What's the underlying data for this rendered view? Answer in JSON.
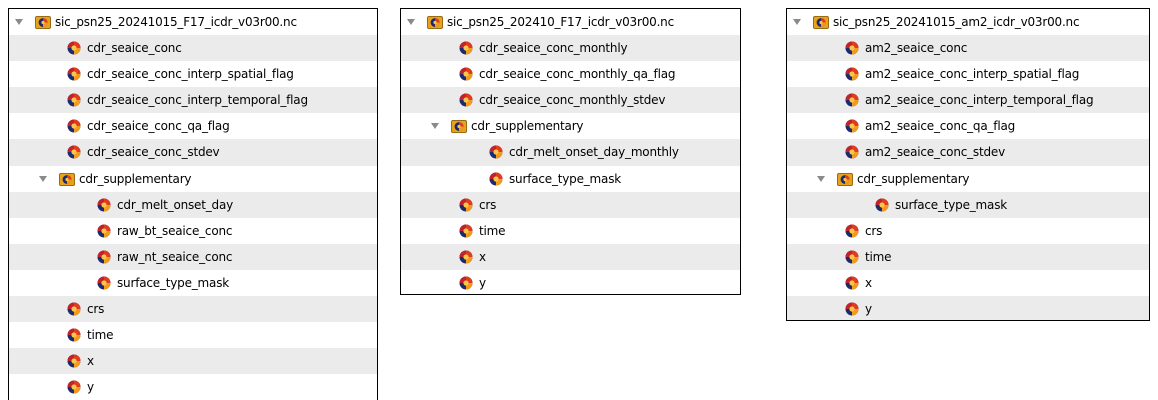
{
  "panels": [
    {
      "id": "a",
      "root": "sic_psn25_20241015_F17_icdr_v03r00.nc",
      "items": [
        {
          "label": "cdr_seaice_conc",
          "level": 1,
          "type": "var"
        },
        {
          "label": "cdr_seaice_conc_interp_spatial_flag",
          "level": 1,
          "type": "var"
        },
        {
          "label": "cdr_seaice_conc_interp_temporal_flag",
          "level": 1,
          "type": "var"
        },
        {
          "label": "cdr_seaice_conc_qa_flag",
          "level": 1,
          "type": "var"
        },
        {
          "label": "cdr_seaice_conc_stdev",
          "level": 1,
          "type": "var"
        },
        {
          "label": "cdr_supplementary",
          "level": 1,
          "type": "group"
        },
        {
          "label": "cdr_melt_onset_day",
          "level": 2,
          "type": "var"
        },
        {
          "label": "raw_bt_seaice_conc",
          "level": 2,
          "type": "var"
        },
        {
          "label": "raw_nt_seaice_conc",
          "level": 2,
          "type": "var"
        },
        {
          "label": "surface_type_mask",
          "level": 2,
          "type": "var"
        },
        {
          "label": "crs",
          "level": 1,
          "type": "var"
        },
        {
          "label": "time",
          "level": 1,
          "type": "var"
        },
        {
          "label": "x",
          "level": 1,
          "type": "var"
        },
        {
          "label": "y",
          "level": 1,
          "type": "var"
        }
      ]
    },
    {
      "id": "b",
      "root": "sic_psn25_202410_F17_icdr_v03r00.nc",
      "items": [
        {
          "label": "cdr_seaice_conc_monthly",
          "level": 1,
          "type": "var"
        },
        {
          "label": "cdr_seaice_conc_monthly_qa_flag",
          "level": 1,
          "type": "var"
        },
        {
          "label": "cdr_seaice_conc_monthly_stdev",
          "level": 1,
          "type": "var"
        },
        {
          "label": "cdr_supplementary",
          "level": 1,
          "type": "group"
        },
        {
          "label": "cdr_melt_onset_day_monthly",
          "level": 2,
          "type": "var"
        },
        {
          "label": "surface_type_mask",
          "level": 2,
          "type": "var"
        },
        {
          "label": "crs",
          "level": 1,
          "type": "var"
        },
        {
          "label": "time",
          "level": 1,
          "type": "var"
        },
        {
          "label": "x",
          "level": 1,
          "type": "var"
        },
        {
          "label": "y",
          "level": 1,
          "type": "var"
        }
      ]
    },
    {
      "id": "c",
      "root": "sic_psn25_20241015_am2_icdr_v03r00.nc",
      "items": [
        {
          "label": "am2_seaice_conc",
          "level": 1,
          "type": "var"
        },
        {
          "label": "am2_seaice_conc_interp_spatial_flag",
          "level": 1,
          "type": "var"
        },
        {
          "label": "am2_seaice_conc_interp_temporal_flag",
          "level": 1,
          "type": "var"
        },
        {
          "label": "am2_seaice_conc_qa_flag",
          "level": 1,
          "type": "var"
        },
        {
          "label": "am2_seaice_conc_stdev",
          "level": 1,
          "type": "var"
        },
        {
          "label": "cdr_supplementary",
          "level": 1,
          "type": "group"
        },
        {
          "label": "surface_type_mask",
          "level": 2,
          "type": "var"
        },
        {
          "label": "crs",
          "level": 1,
          "type": "var"
        },
        {
          "label": "time",
          "level": 1,
          "type": "var"
        },
        {
          "label": "x",
          "level": 1,
          "type": "var"
        },
        {
          "label": "y",
          "level": 1,
          "type": "var"
        }
      ]
    }
  ],
  "icons": {
    "root": "netcdf-file-icon",
    "group": "netcdf-group-icon",
    "var": "netcdf-variable-icon",
    "expanded": "expand-triangle-icon"
  }
}
